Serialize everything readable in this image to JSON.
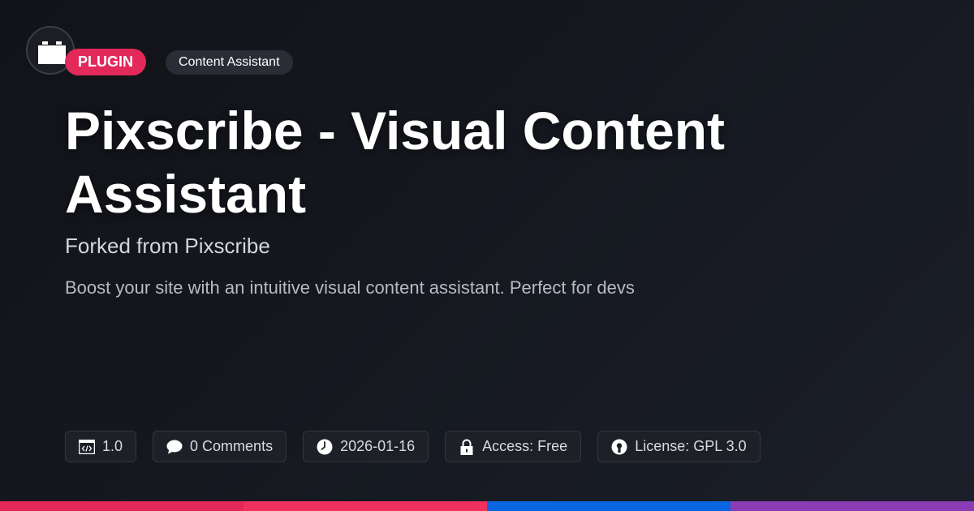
{
  "badges": {
    "type": "PLUGIN",
    "category": "Content Assistant"
  },
  "title": "Pixscribe - Visual Content Assistant",
  "subtitle": "Forked from Pixscribe",
  "description": "Boost your site with an intuitive visual content assistant. Perfect for devs",
  "meta": [
    {
      "icon": "code-window-icon",
      "text": "1.0"
    },
    {
      "icon": "comment-icon",
      "text": "0 Comments"
    },
    {
      "icon": "clock-icon",
      "text": "2026-01-16"
    },
    {
      "icon": "lock-icon",
      "text": "Access: Free"
    },
    {
      "icon": "license-icon",
      "text": "License: GPL 3.0"
    }
  ],
  "colors": {
    "plugin_badge": "#e2295a",
    "bar_segments": [
      "#e2295a",
      "#f0315f",
      "#0a66e0",
      "#8a3cb4"
    ]
  },
  "logo": {
    "icon": "plugin-block-icon"
  }
}
